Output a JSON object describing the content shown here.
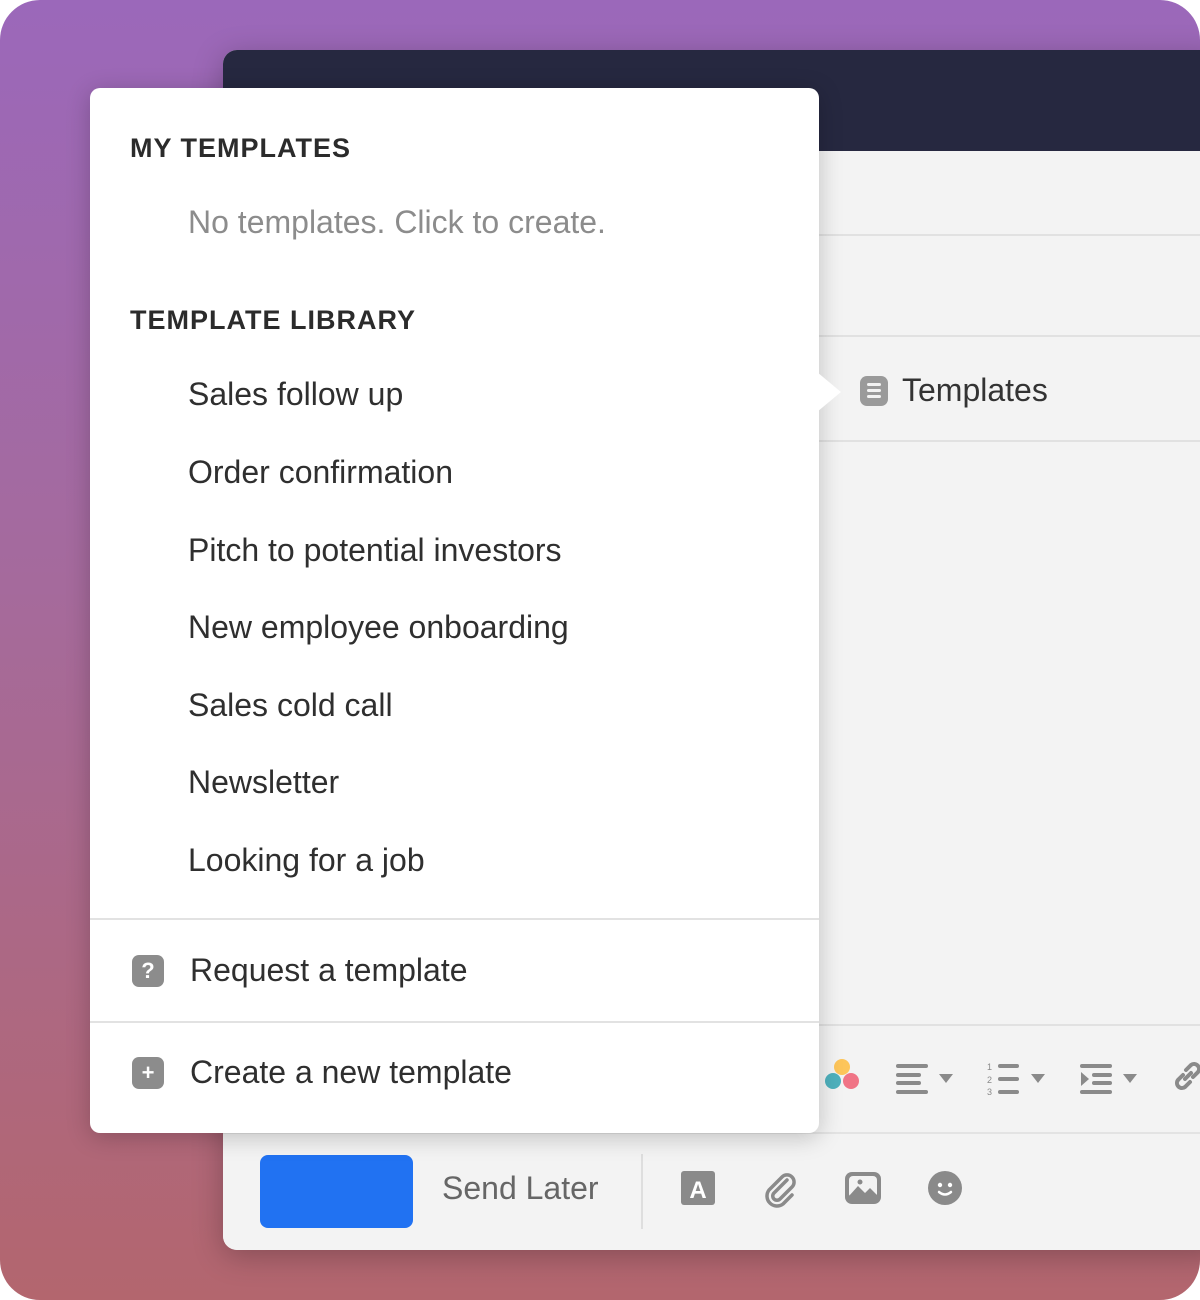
{
  "popup": {
    "my_templates": {
      "title": "MY TEMPLATES",
      "empty_hint": "No templates. Click to create."
    },
    "library": {
      "title": "TEMPLATE LIBRARY",
      "items": [
        {
          "label": "Sales follow up"
        },
        {
          "label": "Order confirmation"
        },
        {
          "label": "Pitch to potential investors"
        },
        {
          "label": "New employee onboarding"
        },
        {
          "label": "Sales cold call"
        },
        {
          "label": "Newsletter"
        },
        {
          "label": "Looking for a job"
        }
      ]
    },
    "actions": {
      "request": {
        "label": "Request a template",
        "icon": "question-icon"
      },
      "create": {
        "label": "Create a new template",
        "icon": "plus-icon"
      }
    }
  },
  "composer": {
    "templates_button": {
      "label": "Templates",
      "icon": "document-lines-icon"
    },
    "send_later": "Send Later",
    "send_button_color": "#2172f2",
    "format_tools": [
      "color-picker-icon",
      "align-icon",
      "numbered-list-icon",
      "indent-icon",
      "link-icon"
    ],
    "bottom_tools": [
      "text-format-icon",
      "paperclip-icon",
      "image-icon",
      "emoji-icon"
    ]
  }
}
